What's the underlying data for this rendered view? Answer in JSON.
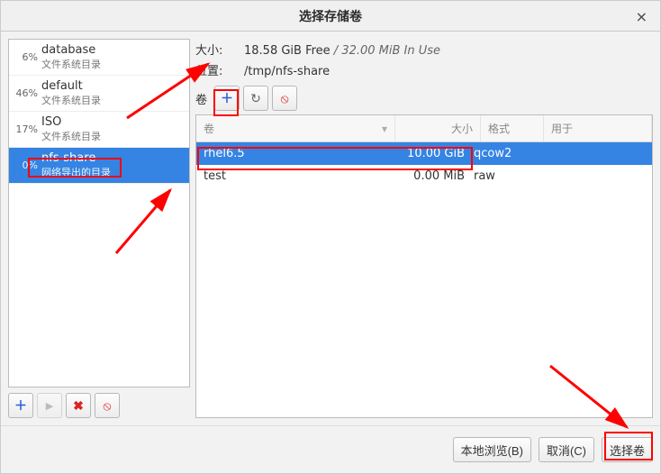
{
  "window": {
    "title": "选择存储卷",
    "close_glyph": "×"
  },
  "sidebar": {
    "pools": [
      {
        "pct": "6%",
        "name": "database",
        "type": "文件系统目录"
      },
      {
        "pct": "46%",
        "name": "default",
        "type": "文件系统目录"
      },
      {
        "pct": "17%",
        "name": "ISO",
        "type": "文件系统目录"
      },
      {
        "pct": "0%",
        "name": "nfs-share",
        "type": "网络导出的目录"
      }
    ],
    "selected_index": 3,
    "toolbar": {
      "add_glyph": "＋",
      "start_glyph": "▶",
      "delete_glyph": "✖",
      "stop_glyph": "⦸"
    }
  },
  "info": {
    "size_label": "大小:",
    "size_free": "18.58 GiB Free",
    "size_sep": " / ",
    "size_used": "32.00 MiB In Use",
    "loc_label": "位置:",
    "loc_value": "/tmp/nfs-share"
  },
  "vol_toolbar": {
    "label": "卷",
    "add_glyph": "＋",
    "refresh_glyph": "↻",
    "delete_glyph": "⦸"
  },
  "table": {
    "headers": {
      "name": "卷",
      "size": "大小",
      "format": "格式",
      "used_by": "用于"
    },
    "sort_glyph": "▾",
    "rows": [
      {
        "name": "rhel6.5",
        "size": "10.00 GiB",
        "format": "qcow2",
        "used_by": ""
      },
      {
        "name": "test",
        "size": "0.00 MiB",
        "format": "raw",
        "used_by": ""
      }
    ],
    "selected_index": 0
  },
  "footer": {
    "browse": "本地浏览(B)",
    "cancel": "取消(C)",
    "choose": "选择卷"
  },
  "colors": {
    "accent": "#3584e4",
    "annotation": "#ff0000"
  }
}
